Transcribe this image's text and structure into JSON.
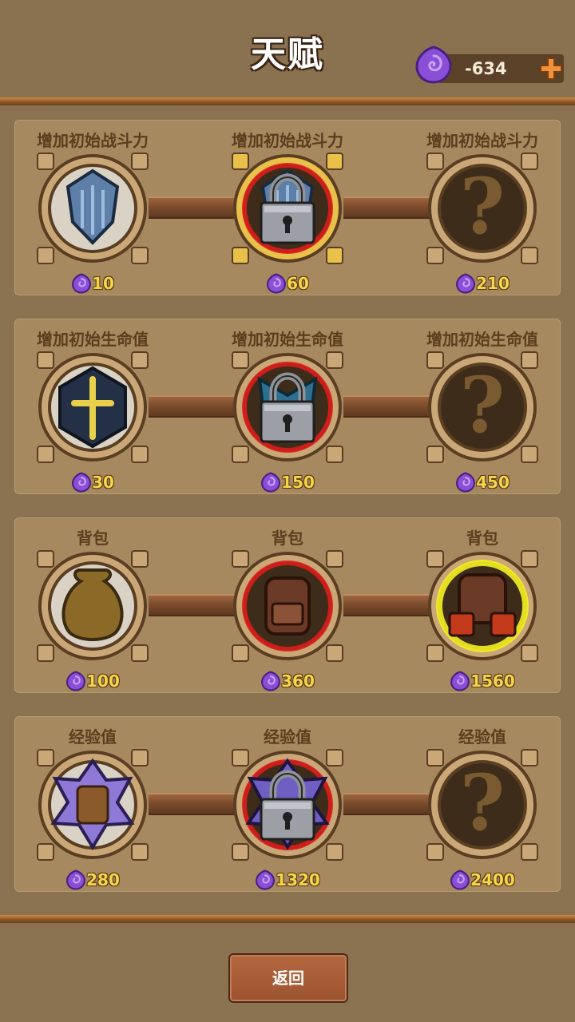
{
  "header": {
    "title": "天赋"
  },
  "currency": {
    "value": "-634",
    "icon": "purple-gem-icon",
    "add_icon": "plus-icon"
  },
  "rows": [
    {
      "label": "增加初始战斗力",
      "nodes": [
        {
          "label": "增加初始战斗力",
          "cost": "10",
          "state": "unlocked",
          "icon": "armor-shield-icon"
        },
        {
          "label": "增加初始战斗力",
          "cost": "60",
          "state": "locked",
          "icon": "armor-shield-icon"
        },
        {
          "label": "增加初始战斗力",
          "cost": "210",
          "state": "unknown",
          "icon": "question-mark-icon"
        }
      ]
    },
    {
      "label": "增加初始生命值",
      "nodes": [
        {
          "label": "增加初始生命值",
          "cost": "30",
          "state": "unlocked",
          "icon": "holy-cross-icon"
        },
        {
          "label": "增加初始生命值",
          "cost": "150",
          "state": "locked",
          "icon": "winged-emblem-icon"
        },
        {
          "label": "增加初始生命值",
          "cost": "450",
          "state": "unknown",
          "icon": "question-mark-icon"
        }
      ]
    },
    {
      "label": "背包",
      "nodes": [
        {
          "label": "背包",
          "cost": "100",
          "state": "unlocked",
          "icon": "sack-icon"
        },
        {
          "label": "背包",
          "cost": "360",
          "state": "available",
          "icon": "backpack-icon"
        },
        {
          "label": "背包",
          "cost": "1560",
          "state": "highlighted",
          "icon": "large-backpack-icon"
        }
      ]
    },
    {
      "label": "经验值",
      "nodes": [
        {
          "label": "经验值",
          "cost": "280",
          "state": "unlocked",
          "icon": "spellbook-icon"
        },
        {
          "label": "经验值",
          "cost": "1320",
          "state": "locked",
          "icon": "rune-tome-icon"
        },
        {
          "label": "经验值",
          "cost": "2400",
          "state": "unknown",
          "icon": "question-mark-icon"
        }
      ]
    }
  ],
  "footer": {
    "back_label": "返回"
  },
  "colors": {
    "background": "#8b7352",
    "panel": "#a6895f",
    "cost_text": "#f5d54a",
    "gem": "#8a4fd6",
    "locked_glow": "#e01a1a",
    "highlight_glow": "#f4f020"
  }
}
